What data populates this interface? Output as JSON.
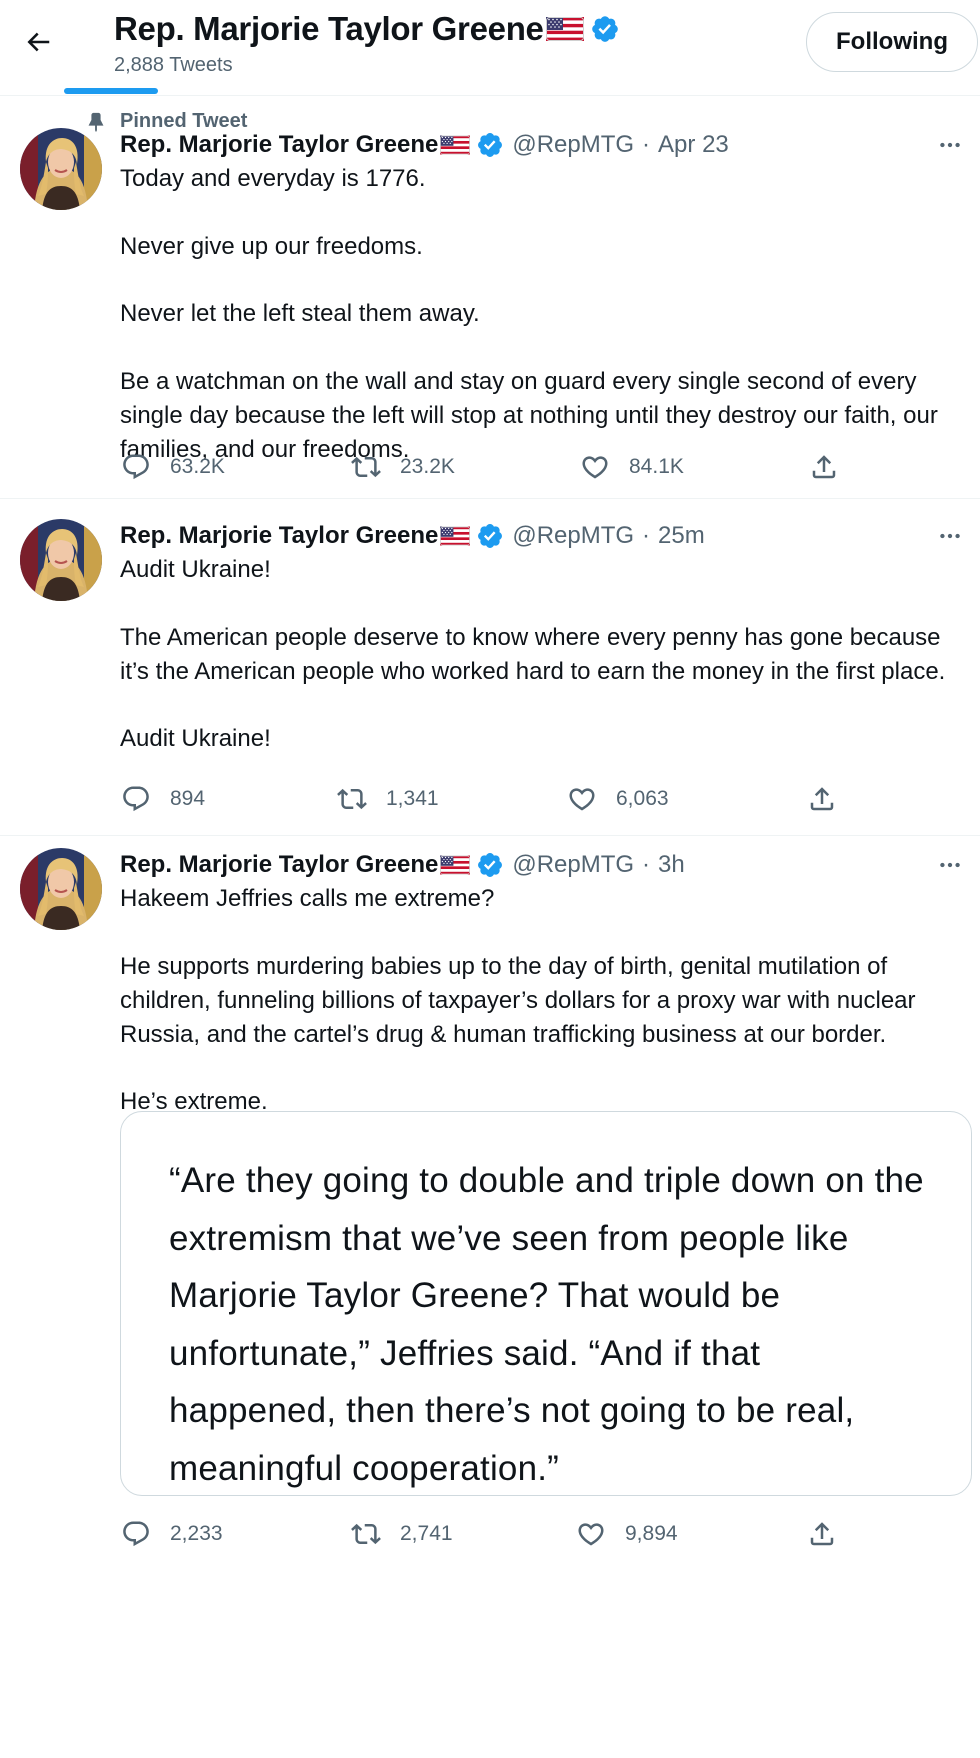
{
  "header": {
    "name": "Rep. Marjorie Taylor Greene",
    "tweet_count": "2,888 Tweets",
    "following_label": "Following"
  },
  "pinned_label": "Pinned Tweet",
  "tweets": [
    {
      "name": "Rep. Marjorie Taylor Greene",
      "handle": "@RepMTG",
      "dot": "·",
      "time": "Apr 23",
      "paragraphs": [
        "Today and everyday is 1776.",
        "Never give up our freedoms.",
        "Never let the left steal them away.",
        "Be a watchman on the wall and stay on guard every single second of every single day because the left will stop at nothing until they destroy our faith, our families, and our freedoms."
      ],
      "replies": "63.2K",
      "retweets": "23.2K",
      "likes": "84.1K"
    },
    {
      "name": "Rep. Marjorie Taylor Greene",
      "handle": "@RepMTG",
      "dot": "·",
      "time": "25m",
      "paragraphs": [
        "Audit Ukraine!",
        "The American people deserve to know where every penny has gone because it’s the American people who worked hard to earn the money in the first place.",
        "Audit Ukraine!"
      ],
      "replies": "894",
      "retweets": "1,341",
      "likes": "6,063"
    },
    {
      "name": "Rep. Marjorie Taylor Greene",
      "handle": "@RepMTG",
      "dot": "·",
      "time": "3h",
      "paragraphs": [
        "Hakeem Jeffries calls me extreme?",
        "He supports murdering babies up to the day of birth, genital mutilation of children, funneling billions of taxpayer’s dollars for a proxy war with nuclear Russia, and the cartel’s drug & human trafficking business at our border.",
        "He’s extreme."
      ],
      "quote": "“Are they going to double and triple down on the extremism that we’ve seen from people like Marjorie Taylor Greene? That would be unfortunate,” Jeffries said. “And if that happened, then there’s not going to be real, meaningful cooperation.”",
      "replies": "2,233",
      "retweets": "2,741",
      "likes": "9,894"
    }
  ],
  "icons": {
    "back": "arrow-left-icon",
    "pin": "pin-icon",
    "verified": "verified-badge-icon",
    "flag": "us-flag-icon",
    "more": "more-horizontal-icon",
    "reply": "reply-icon",
    "retweet": "retweet-icon",
    "like": "heart-icon",
    "share": "share-icon"
  },
  "colors": {
    "accent": "#1d9bf0",
    "text": "#0f1419",
    "secondary": "#536471",
    "border": "#eff3f4"
  }
}
